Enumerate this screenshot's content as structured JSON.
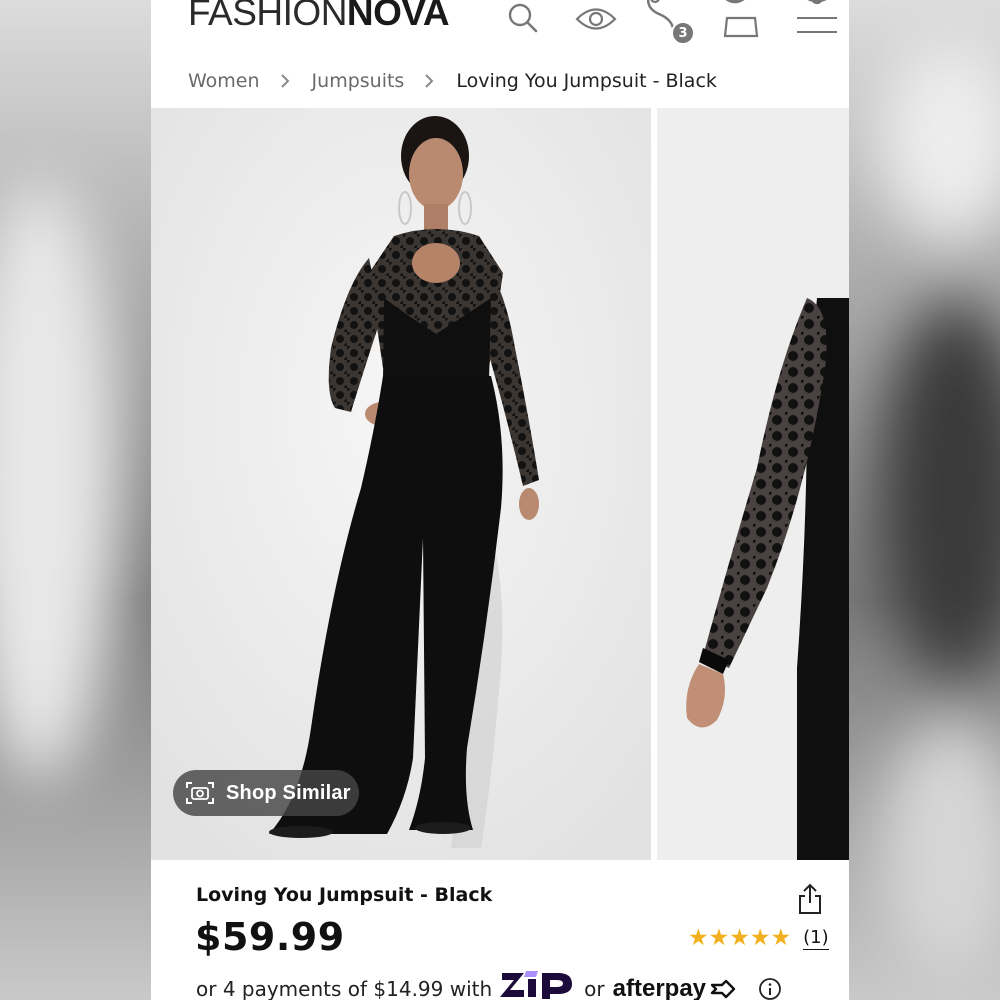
{
  "brand": {
    "logo_part1": "FASHION",
    "logo_part2": "NOVA"
  },
  "header": {
    "icons": [
      "search-icon",
      "eye-icon",
      "measure-icon",
      "user-icon",
      "bag-icon",
      "menu-icon"
    ],
    "cart_badge": "3"
  },
  "breadcrumb": {
    "items": [
      "Women",
      "Jumpsuits",
      "Loving You Jumpsuit - Black"
    ]
  },
  "gallery": {
    "shop_similar_label": "Shop Similar",
    "shop_similar_icon": "camera-icon"
  },
  "product": {
    "title": "Loving You Jumpsuit - Black",
    "price": "$59.99",
    "rating_stars": "★★★★★",
    "rating_value": 5,
    "review_count": "(1)",
    "payments": {
      "prefix": "or 4 payments of $14.99 with",
      "zip_label": "Zip",
      "or_label": "or",
      "afterpay_label": "afterpay"
    }
  },
  "colors": {
    "star": "#f2b01e",
    "text": "#111111",
    "breadcrumb": "#6a6a6a",
    "zip_brand": "#1b0a3a"
  }
}
